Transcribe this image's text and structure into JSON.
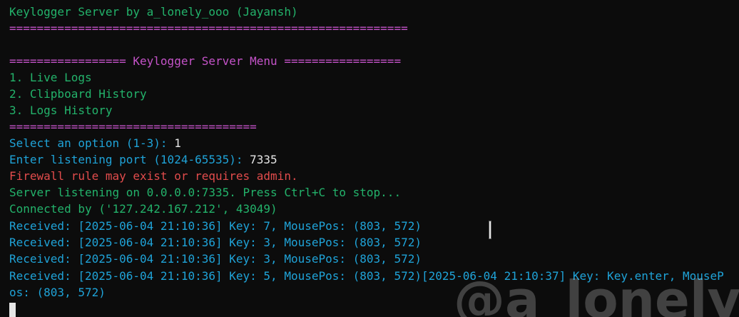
{
  "title": "Keylogger Server by a_lonely_ooo (Jayansh)",
  "title_rule": "==========================================================",
  "menu": {
    "header": "================= Keylogger Server Menu =================",
    "items": [
      "1. Live Logs",
      "2. Clipboard History",
      "3. Logs History"
    ],
    "footer_rule": "===================================="
  },
  "prompts": {
    "select_label": "Select an option (1-3): ",
    "select_value": "1",
    "port_label": "Enter listening port (1024-65535): ",
    "port_value": "7335"
  },
  "messages": {
    "firewall_warning": "Firewall rule may exist or requires admin.",
    "listening": "Server listening on 0.0.0.0:7335. Press Ctrl+C to stop...",
    "connected": "Connected by ('127.242.167.212', 43049)"
  },
  "received_lines": [
    "Received: [2025-06-04 21:10:36] Key: 7, MousePos: (803, 572)",
    "Received: [2025-06-04 21:10:36] Key: 3, MousePos: (803, 572)",
    "Received: [2025-06-04 21:10:36] Key: 3, MousePos: (803, 572)",
    "Received: [2025-06-04 21:10:36] Key: 5, MousePos: (803, 572)[2025-06-04 21:10:37] Key: Key.enter, MouseP",
    "os: (803, 572)"
  ],
  "watermark": "@a_lonely",
  "colors": {
    "background": "#0c0c0c",
    "green": "#23b36b",
    "magenta": "#c553c9",
    "blue": "#1fa3d8",
    "red": "#e24c4c",
    "white": "#e6e6e6"
  }
}
